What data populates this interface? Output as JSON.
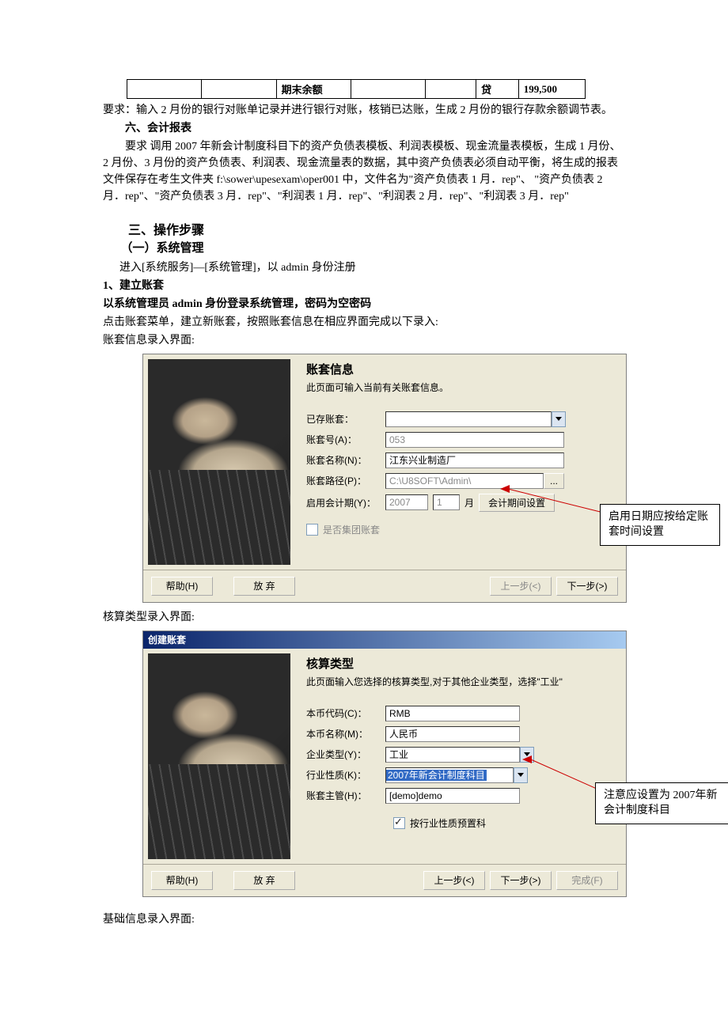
{
  "table": {
    "c3": "期末余额",
    "c6": "贷",
    "c7": "199,500"
  },
  "req1": "要求：输入 2 月份的银行对账单记录并进行银行对账，核销已达账，生成 2 月份的银行存款余额调节表。",
  "h6": "六、会计报表",
  "req2": "要求 调用 2007 年新会计制度科目下的资产负债表模板、利润表模板、现金流量表模板，生成 1 月份、2 月份、3 月份的资产负债表、利润表、现金流量表的数据，其中资产负债表必须自动平衡，将生成的报表文件保存在考生文件夹 f:\\sower\\upesexam\\oper001 中，文件名为\"资产负债表 1 月．rep\"、 \"资产负债表 2 月．rep\"、\"资产负债表 3 月．rep\"、\"利润表 1 月．rep\"、\"利润表 2 月．rep\"、\"利润表 3 月．rep\"",
  "h3": "三、操作步骤",
  "s1": "（一）系统管理",
  "line_a": "进入[系统服务]—[系统管理]，以 admin 身份注册",
  "s1_1": "1、建立账套",
  "s1_2": "以系统管理员 admin 身份登录系统管理，密码为空密码",
  "line_b": "点击账套菜单，建立新账套，按照账套信息在相应界面完成以下录入:",
  "line_c": "账套信息录入界面:",
  "dlg1": {
    "title": "账套信息",
    "desc": "此页面可输入当前有关账套信息。",
    "l_exist": "已存账套：",
    "l_no": "账套号(A)：",
    "v_no": "053",
    "l_name": "账套名称(N)：",
    "v_name": "江东兴业制造厂",
    "l_path": "账套路径(P)：",
    "v_path": "C:\\U8SOFT\\Admin\\",
    "l_period": "启用会计期(Y)：",
    "v_year": "2007",
    "v_month": "1",
    "month_suffix": "月",
    "btn_period": "会计期间设置",
    "chk_group": "是否集团账套",
    "callout": "启用日期应按给定账套时间设置"
  },
  "line_d": "核算类型录入界面:",
  "dlg2": {
    "titlebar": "创建账套",
    "title": "核算类型",
    "desc": "此页面输入您选择的核算类型,对于其他企业类型，选择\"工业\"",
    "l_code": "本币代码(C)：",
    "v_code": "RMB",
    "l_curname": "本币名称(M)：",
    "v_curname": "人民币",
    "l_enttype": "企业类型(Y)：",
    "v_enttype": "工业",
    "l_industry": "行业性质(K)：",
    "v_industry": "2007年新会计制度科目",
    "l_admin": "账套主管(H)：",
    "v_admin": "[demo]demo",
    "chk_preset": "按行业性质预置科",
    "callout": "注意应设置为 2007年新会计制度科目"
  },
  "buttons": {
    "help": "帮助(H)",
    "cancel": "放 弃",
    "prev": "上一步(<)",
    "next": "下一步(>)",
    "finish": "完成(F)"
  },
  "line_e": "基础信息录入界面:"
}
